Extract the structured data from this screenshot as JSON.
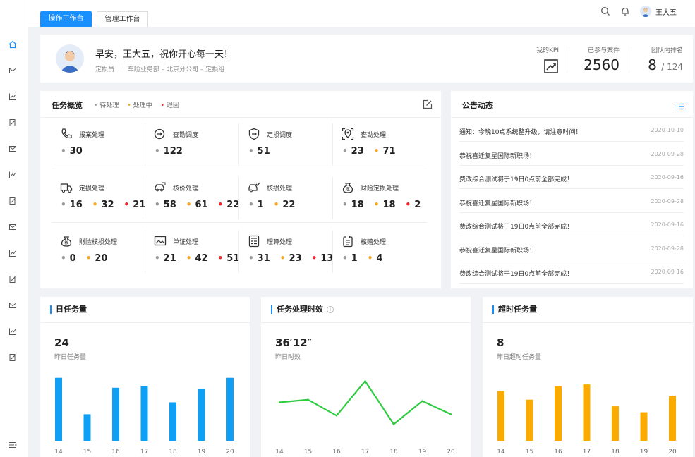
{
  "topbar": {
    "tabs": [
      {
        "label": "操作工作台",
        "active": true
      },
      {
        "label": "管理工作台",
        "active": false
      }
    ],
    "user_name": "王大五"
  },
  "welcome": {
    "greeting": "早安，王大五，祝你开心每一天！",
    "role": "定损员",
    "org_path": "车险业务部 – 北京分公司 – 定损组"
  },
  "kpis": {
    "my_kpi_label": "我的KPI",
    "cases_label": "已参与案件",
    "cases_value": "2560",
    "rank_label": "团队内排名",
    "rank_value": "8",
    "rank_total": "/ 124"
  },
  "tasks": {
    "title": "任务概览",
    "legend": {
      "pending": "待处理",
      "processing": "处理中",
      "returned": "退回"
    },
    "items": [
      {
        "name": "报案处理",
        "icon": "phone-icon",
        "pending": "30"
      },
      {
        "name": "查勘调度",
        "icon": "dispatch-icon",
        "pending": "122"
      },
      {
        "name": "定损调度",
        "icon": "shield-icon",
        "pending": "51"
      },
      {
        "name": "查勘处理",
        "icon": "location-icon",
        "pending": "23",
        "processing": "71"
      },
      {
        "name": "定损处理",
        "icon": "truck-icon",
        "pending": "16",
        "processing": "32",
        "returned": "21"
      },
      {
        "name": "核价处理",
        "icon": "car-price-icon",
        "pending": "58",
        "processing": "61",
        "returned": "22"
      },
      {
        "name": "核损处理",
        "icon": "car-check-icon",
        "pending": "1",
        "processing": "22"
      },
      {
        "name": "财险定损处理",
        "icon": "moneybag-icon",
        "pending": "18",
        "processing": "18",
        "returned": "2"
      },
      {
        "name": "财险核损处理",
        "icon": "moneybag-check-icon",
        "pending": "0",
        "processing": "20"
      },
      {
        "name": "单证处理",
        "icon": "document-image-icon",
        "pending": "21",
        "processing": "42",
        "returned": "51"
      },
      {
        "name": "理算处理",
        "icon": "calculator-icon",
        "pending": "31",
        "processing": "23",
        "returned": "13"
      },
      {
        "name": "核赔处理",
        "icon": "clipboard-icon",
        "pending": "1",
        "processing": "4"
      }
    ]
  },
  "notices": {
    "title": "公告动态",
    "items": [
      {
        "text": "通知：今晚10点系统整升级，请注意时间！",
        "date": "2020-10-10"
      },
      {
        "text": "恭祝喜迁复星国际新职场！",
        "date": "2020-09-28"
      },
      {
        "text": "费改综合测试将于19日0点前全部完成！",
        "date": "2020-09-16"
      },
      {
        "text": "恭祝喜迁复星国际新职场！",
        "date": "2020-09-28"
      },
      {
        "text": "费改综合测试将于19日0点前全部完成！",
        "date": "2020-09-16"
      },
      {
        "text": "恭祝喜迁复星国际新职场！",
        "date": "2020-09-28"
      },
      {
        "text": "费改综合测试将于19日0点前全部完成！",
        "date": "2020-09-16"
      }
    ]
  },
  "stats": {
    "daily": {
      "title": "日任务量",
      "value": "24",
      "label": "昨日任务量"
    },
    "timing": {
      "title": "任务处理时效",
      "value": "36′12″",
      "label": "昨日时效"
    },
    "overtime": {
      "title": "超时任务量",
      "value": "8",
      "label": "昨日超时任务量"
    }
  },
  "chart_data": [
    {
      "type": "bar",
      "categories": [
        "14",
        "15",
        "16",
        "17",
        "18",
        "19",
        "20"
      ],
      "values": [
        95,
        40,
        80,
        83,
        58,
        78,
        95
      ],
      "color": "#0fa0f5"
    },
    {
      "type": "line",
      "categories": [
        "14",
        "15",
        "16",
        "17",
        "18",
        "19",
        "20"
      ],
      "values": [
        58,
        62,
        38,
        90,
        25,
        60,
        40
      ],
      "color": "#2ecc40"
    },
    {
      "type": "bar",
      "categories": [
        "14",
        "15",
        "16",
        "17",
        "18",
        "19",
        "20"
      ],
      "values": [
        75,
        62,
        82,
        85,
        52,
        43,
        68
      ],
      "color": "#fbab00"
    }
  ],
  "colors": {
    "accent": "#1890ff",
    "pending": "#999999",
    "processing": "#f5a623",
    "returned": "#f5222d"
  }
}
